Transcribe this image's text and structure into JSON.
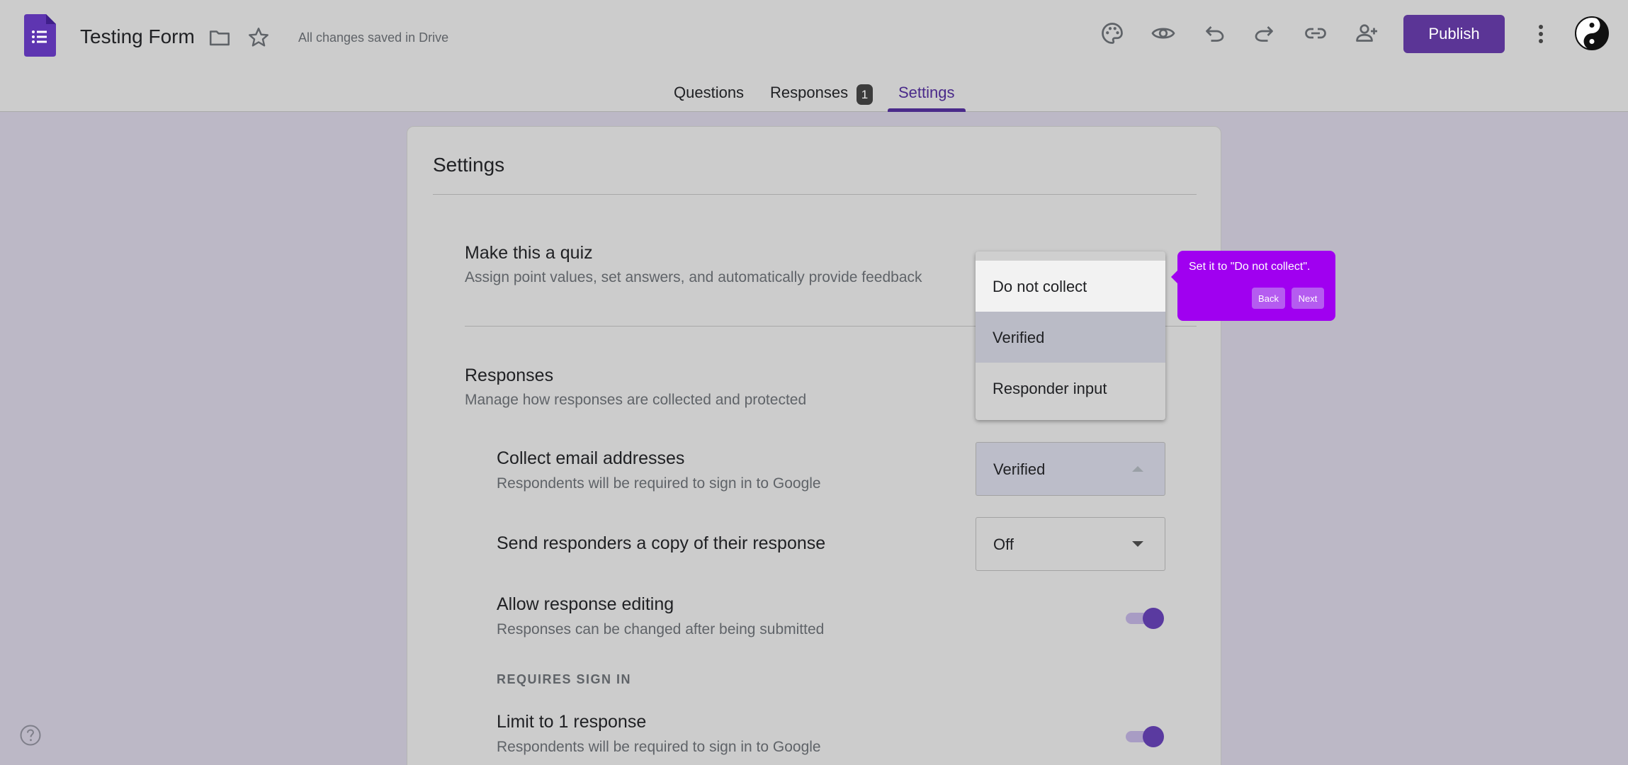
{
  "header": {
    "title": "Testing Form",
    "save_status": "All changes saved in Drive",
    "publish_label": "Publish",
    "icons": [
      "forms-logo-icon",
      "folder-icon",
      "star-icon",
      "palette-icon",
      "eye-icon",
      "undo-icon",
      "redo-icon",
      "link-icon",
      "add-person-icon",
      "more-vert-icon",
      "avatar"
    ]
  },
  "tabs": [
    {
      "label": "Questions"
    },
    {
      "label": "Responses",
      "badge": "1"
    },
    {
      "label": "Settings",
      "active": true
    }
  ],
  "settings": {
    "title": "Settings",
    "quiz": {
      "heading": "Make this a quiz",
      "desc": "Assign point values, set answers, and automatically provide feedback"
    },
    "responses": {
      "heading": "Responses",
      "desc": "Manage how responses are collected and protected"
    },
    "collect_email": {
      "heading": "Collect email addresses",
      "desc": "Respondents will be required to sign in to Google",
      "value": "Verified"
    },
    "send_copy": {
      "heading": "Send responders a copy of their response",
      "value": "Off"
    },
    "allow_editing": {
      "heading": "Allow response editing",
      "desc": "Responses can be changed after being submitted",
      "on": true
    },
    "requires_sign_in_label": "REQUIRES SIGN IN",
    "limit_one": {
      "heading": "Limit to 1 response",
      "desc": "Respondents will be required to sign in to Google",
      "on": true
    }
  },
  "dropdown": {
    "options": [
      "Do not collect",
      "Verified",
      "Responder input"
    ],
    "highlighted": "Do not collect",
    "selected": "Verified"
  },
  "tooltip": {
    "text": "Set it to \"Do not collect\".",
    "back_label": "Back",
    "next_label": "Next",
    "color": "#a000f0"
  },
  "colors": {
    "accent": "#5b3596",
    "overlay": "#bcb8c6"
  }
}
